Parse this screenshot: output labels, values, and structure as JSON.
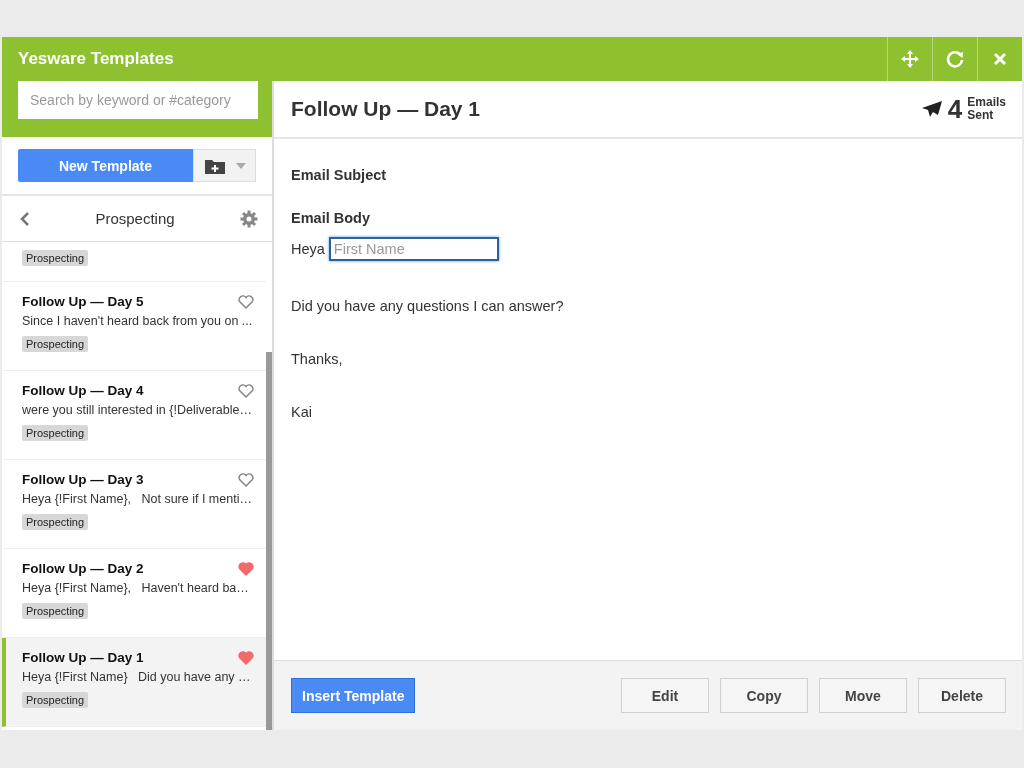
{
  "window": {
    "title": "Yesware Templates"
  },
  "search": {
    "placeholder": "Search by keyword or #category"
  },
  "new_template_button": "New Template",
  "category": {
    "name": "Prospecting"
  },
  "templates": [
    {
      "kind": "partial",
      "tag": "Prospecting",
      "selected": false
    },
    {
      "kind": "full",
      "title": "Follow Up — Day 5",
      "preview": "Since I haven't heard back from you on ...",
      "tag": "Prospecting",
      "favorite": false,
      "selected": false
    },
    {
      "kind": "full",
      "title": "Follow Up — Day 4",
      "preview": "were you still interested in {!Deliverable…",
      "tag": "Prospecting",
      "favorite": false,
      "selected": false
    },
    {
      "kind": "full",
      "title": "Follow Up — Day 3",
      "preview": "Heya {!First Name},   Not sure if I menti…",
      "tag": "Prospecting",
      "favorite": false,
      "selected": false
    },
    {
      "kind": "full",
      "title": "Follow Up — Day 2",
      "preview": "Heya {!First Name},   Haven't heard ba…",
      "tag": "Prospecting",
      "favorite": true,
      "selected": false
    },
    {
      "kind": "full",
      "title": "Follow Up — Day 1",
      "preview": "Heya {!First Name}   Did you have any …",
      "tag": "Prospecting",
      "favorite": true,
      "selected": true
    }
  ],
  "detail": {
    "title": "Follow Up — Day 1",
    "sent_count": "4",
    "sent_label_1": "Emails",
    "sent_label_2": "Sent",
    "subject_label": "Email Subject",
    "body_label": "Email Body",
    "greeting": "Heya",
    "field_placeholder": "First Name",
    "paragraphs": [
      "Did you have any questions I can answer?",
      "Thanks,",
      "Kai"
    ]
  },
  "footer": {
    "insert_button": "Insert Template",
    "actions": [
      "Edit",
      "Copy",
      "Move",
      "Delete"
    ]
  }
}
